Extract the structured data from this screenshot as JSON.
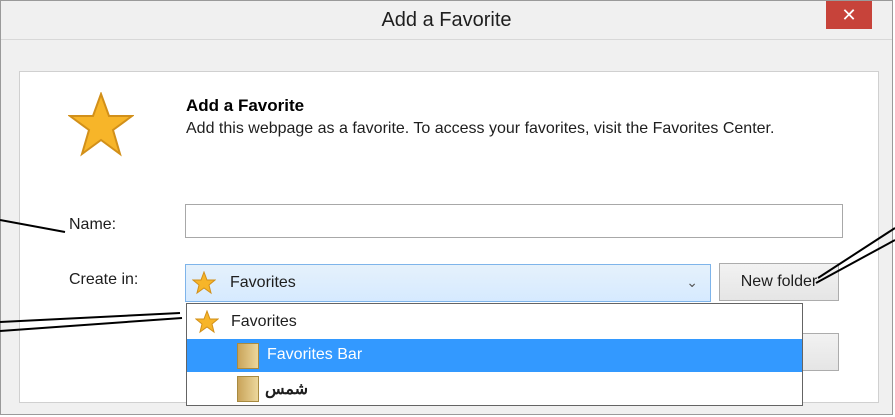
{
  "dialog": {
    "title": "Add a Favorite",
    "close_glyph": "✕",
    "heading": "Add a Favorite",
    "description": "Add this webpage as a favorite. To access your favorites, visit the Favorites Center.",
    "name_label": "Name:",
    "name_value": "",
    "create_in_label": "Create in:",
    "create_in_value": "Favorites",
    "new_folder_label": "New folder",
    "dropdown_arrow": "⌄"
  },
  "dropdown": {
    "items": [
      {
        "label": "Favorites",
        "icon": "star-icon",
        "selected": false
      },
      {
        "label": "Favorites Bar",
        "icon": "folder-icon",
        "selected": true
      },
      {
        "label": "شمس",
        "icon": "folder-icon",
        "selected": false
      }
    ]
  },
  "colors": {
    "selection": "#3399ff",
    "close": "#c7433a",
    "star": "#f7b529"
  }
}
